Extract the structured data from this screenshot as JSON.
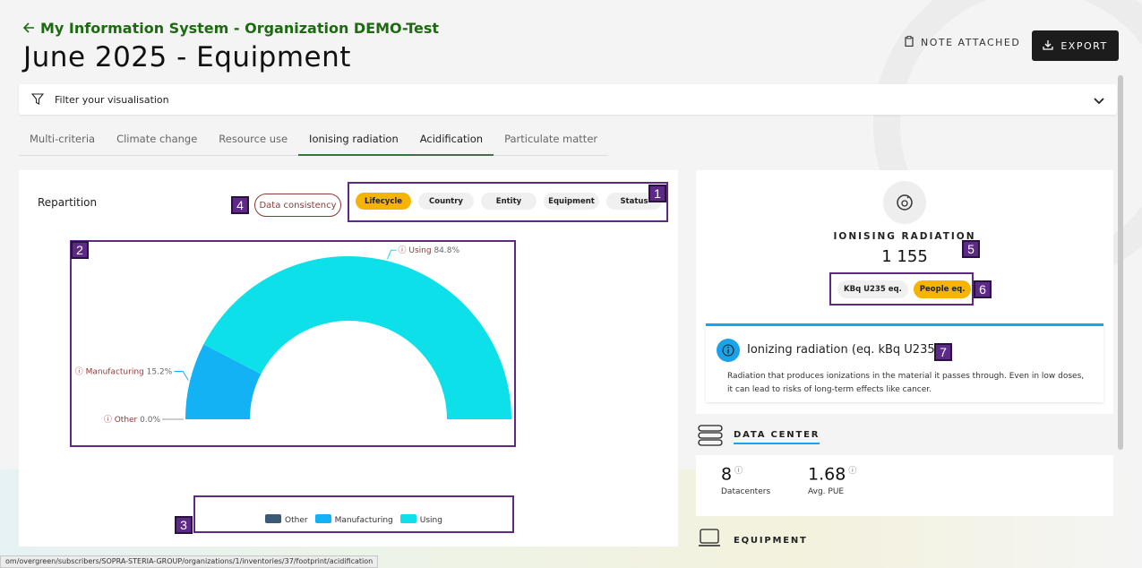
{
  "header": {
    "back_label": "My Information System - Organization DEMO-Test",
    "title": "June 2025 - Equipment",
    "note_label": "NOTE ATTACHED",
    "export_label": "EXPORT"
  },
  "filter": {
    "label": "Filter your visualisation"
  },
  "tabs": [
    {
      "label": "Multi-criteria"
    },
    {
      "label": "Climate change"
    },
    {
      "label": "Resource use"
    },
    {
      "label": "Ionising radiation"
    },
    {
      "label": "Acidification"
    },
    {
      "label": "Particulate matter"
    }
  ],
  "repartition": {
    "title": "Repartition",
    "consistency_label": "Data consistency",
    "groups": [
      {
        "label": "Lifecycle",
        "active": true
      },
      {
        "label": "Country",
        "active": false
      },
      {
        "label": "Entity",
        "active": false
      },
      {
        "label": "Equipment",
        "active": false
      },
      {
        "label": "Status",
        "active": false
      }
    ]
  },
  "chart_data": {
    "type": "pie",
    "subtype": "half-donut",
    "slices": [
      {
        "name": "Other",
        "label": "Other",
        "value": 0.0,
        "pct": "0.0%",
        "color": "#3a5a78"
      },
      {
        "name": "Manufacturing",
        "label": "Manufacturing",
        "value": 15.2,
        "pct": "15.2%",
        "color": "#12b2f4"
      },
      {
        "name": "Using",
        "label": "Using",
        "value": 84.8,
        "pct": "84.8%",
        "color": "#0de0e8"
      }
    ],
    "legend": [
      "Other",
      "Manufacturing",
      "Using"
    ],
    "legend_position": "bottom"
  },
  "kpi": {
    "label": "IONISING RADIATION",
    "value": "1 155",
    "units": [
      {
        "label": "KBq U235 eq.",
        "active": false
      },
      {
        "label": "People eq.",
        "active": true
      }
    ]
  },
  "info": {
    "title": "Ionizing radiation (eq. kBq U235)",
    "description": "Radiation that produces ionizations in the material it passes through. Even in low doses, it can lead to risks of long-term effects like cancer."
  },
  "data_center": {
    "title": "DATA CENTER",
    "stats": [
      {
        "value": "8",
        "label": "Datacenters"
      },
      {
        "value": "1.68",
        "label": "Avg. PUE"
      }
    ]
  },
  "equipment": {
    "title": "EQUIPMENT"
  },
  "annotations": [
    "1",
    "2",
    "3",
    "4",
    "5",
    "6",
    "7"
  ],
  "status_url": "om/overgreen/subscribers/SOPRA-STERIA-GROUP/organizations/1/inventories/37/footprint/acidification"
}
